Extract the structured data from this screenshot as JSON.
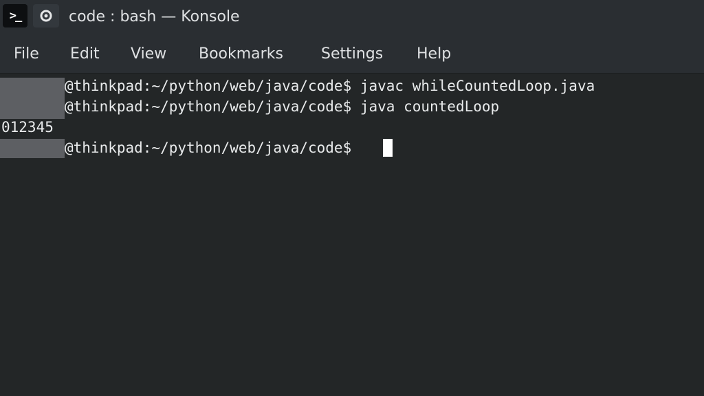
{
  "window": {
    "title": "code : bash — Konsole",
    "app_icon": "terminal-prompt-icon",
    "app_icon_glyph": ">_",
    "pin_icon": "pin-icon"
  },
  "menu": {
    "items": [
      "File",
      "Edit",
      "View",
      "Bookmarks",
      "Settings",
      "Help"
    ]
  },
  "terminal": {
    "lines": [
      "@thinkpad:~/python/web/java/code$ javac whileCountedLoop.java",
      "@thinkpad:~/python/web/java/code$ java countedLoop",
      "012345",
      "@thinkpad:~/python/web/java/code$ "
    ]
  },
  "colors": {
    "chrome": "#2a2e32",
    "terminal_bg": "#232627",
    "text": "#e8eaeb",
    "redaction": "#5d5f63",
    "cursor": "#ffffff"
  }
}
